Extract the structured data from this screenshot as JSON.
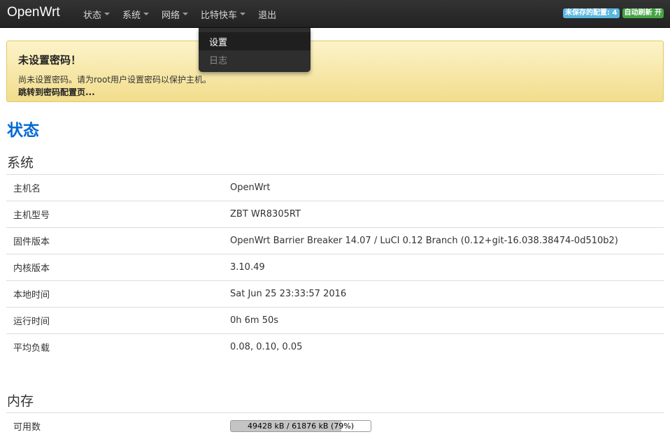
{
  "navbar": {
    "brand": "OpenWrt",
    "menu": [
      {
        "label": "状态",
        "has_caret": true
      },
      {
        "label": "系统",
        "has_caret": true
      },
      {
        "label": "网络",
        "has_caret": true
      },
      {
        "label": "比特快车",
        "has_caret": true
      },
      {
        "label": "退出",
        "has_caret": false
      }
    ],
    "badges": {
      "unsaved": "未保存的配置: 4",
      "auto_refresh": "自动刷新 开"
    }
  },
  "dropdown": {
    "items": [
      "设置",
      "日志"
    ],
    "active_index": 0
  },
  "alert": {
    "title": "未设置密码！",
    "text": "尚未设置密码。请为root用户设置密码以保护主机。",
    "link": "跳转到密码配置页..."
  },
  "page_title": "状态",
  "system": {
    "title": "系统",
    "rows": [
      {
        "label": "主机名",
        "value": "OpenWrt"
      },
      {
        "label": "主机型号",
        "value": "ZBT WR8305RT"
      },
      {
        "label": "固件版本",
        "value": "OpenWrt Barrier Breaker 14.07 / LuCI 0.12 Branch (0.12+git-16.038.38474-0d510b2)"
      },
      {
        "label": "内核版本",
        "value": "3.10.49"
      },
      {
        "label": "本地时间",
        "value": "Sat Jun 25 23:33:57 2016"
      },
      {
        "label": "运行时间",
        "value": "0h 6m 50s"
      },
      {
        "label": "平均负载",
        "value": "0.08, 0.10, 0.05"
      }
    ]
  },
  "memory": {
    "title": "内存",
    "rows": [
      {
        "label": "可用数",
        "value": "49428 kB / 61876 kB (79%)",
        "percent": 79
      }
    ]
  },
  "colors": {
    "navbar_bg": "#222222",
    "title_blue": "#0069d6",
    "badge_unsaved": "#5bb7e0",
    "badge_refresh": "#46a546",
    "alert_bg": "#f7e7a4"
  }
}
